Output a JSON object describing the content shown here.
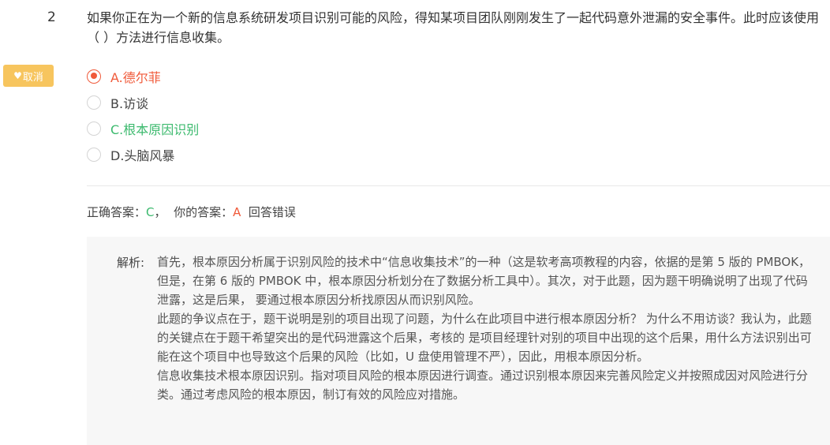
{
  "question": {
    "number": "2",
    "text": "如果你正在为一个新的信息系统研发项目识别可能的风险，得知某项目团队刚刚发生了一起代码意外泄漏的安全事件。此时应该使用（ ）方法进行信息收集。"
  },
  "cancel_button": {
    "icon": "heart-icon",
    "label": "取消"
  },
  "options": [
    {
      "label": "A.德尔菲",
      "state": "selected-wrong"
    },
    {
      "label": "B.访谈",
      "state": "normal"
    },
    {
      "label": "C.根本原因识别",
      "state": "correct"
    },
    {
      "label": "D.头脑风暴",
      "state": "normal"
    }
  ],
  "answer": {
    "correct_prefix": "正确答案：",
    "correct_value": "C",
    "separator": "，",
    "yours_prefix": "你的答案：",
    "yours_value": "A",
    "result": "回答错误"
  },
  "analysis": {
    "label": "解析:",
    "paragraphs": [
      "首先，根本原因分析属于识别风险的技术中“信息收集技术”的一种（这是软考高项教程的内容，依据的是第 5 版的 PMBOK，但是，在第 6 版的 PMBOK 中，根本原因分析划分在了数据分析工具中）。其次，对于此题，因为题干明确说明了出现了代码泄露，这是后果， 要通过根本原因分析找原因从而识别风险。",
      "此题的争议点在于，题干说明是别的项目出现了问题，为什么在此项目中进行根本原因分析？ 为什么不用访谈？我认为，此题的关键点在于题干希望突出的是代码泄露这个后果，考核的 是项目经理针对别的项目中出现的这个后果，用什么方法识别出可能在这个项目中也导致这个后果的风险（比如，U 盘使用管理不严），因此，用根本原因分析。",
      "信息收集技术根本原因识别。指对项目风险的根本原因进行调查。通过识别根本原因来完善风险定义并按照成因对风险进行分类。通过考虑风险的根本原因，制订有效的风险应对措施。"
    ]
  },
  "colors": {
    "wrong": "#f05a3a",
    "correct": "#3cba6e",
    "cancel_bg": "#f7c55e"
  }
}
